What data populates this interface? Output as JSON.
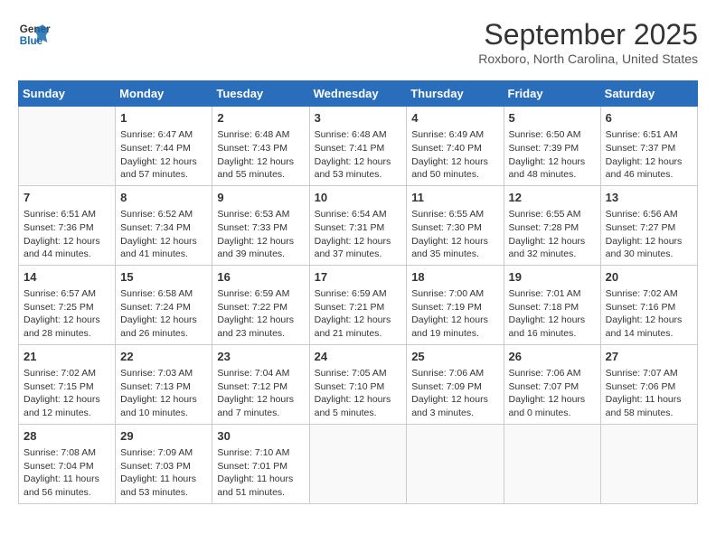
{
  "header": {
    "logo_line1": "General",
    "logo_line2": "Blue",
    "month": "September 2025",
    "location": "Roxboro, North Carolina, United States"
  },
  "weekdays": [
    "Sunday",
    "Monday",
    "Tuesday",
    "Wednesday",
    "Thursday",
    "Friday",
    "Saturday"
  ],
  "weeks": [
    [
      {
        "day": "",
        "info": ""
      },
      {
        "day": "1",
        "info": "Sunrise: 6:47 AM\nSunset: 7:44 PM\nDaylight: 12 hours and 57 minutes."
      },
      {
        "day": "2",
        "info": "Sunrise: 6:48 AM\nSunset: 7:43 PM\nDaylight: 12 hours and 55 minutes."
      },
      {
        "day": "3",
        "info": "Sunrise: 6:48 AM\nSunset: 7:41 PM\nDaylight: 12 hours and 53 minutes."
      },
      {
        "day": "4",
        "info": "Sunrise: 6:49 AM\nSunset: 7:40 PM\nDaylight: 12 hours and 50 minutes."
      },
      {
        "day": "5",
        "info": "Sunrise: 6:50 AM\nSunset: 7:39 PM\nDaylight: 12 hours and 48 minutes."
      },
      {
        "day": "6",
        "info": "Sunrise: 6:51 AM\nSunset: 7:37 PM\nDaylight: 12 hours and 46 minutes."
      }
    ],
    [
      {
        "day": "7",
        "info": "Sunrise: 6:51 AM\nSunset: 7:36 PM\nDaylight: 12 hours and 44 minutes."
      },
      {
        "day": "8",
        "info": "Sunrise: 6:52 AM\nSunset: 7:34 PM\nDaylight: 12 hours and 41 minutes."
      },
      {
        "day": "9",
        "info": "Sunrise: 6:53 AM\nSunset: 7:33 PM\nDaylight: 12 hours and 39 minutes."
      },
      {
        "day": "10",
        "info": "Sunrise: 6:54 AM\nSunset: 7:31 PM\nDaylight: 12 hours and 37 minutes."
      },
      {
        "day": "11",
        "info": "Sunrise: 6:55 AM\nSunset: 7:30 PM\nDaylight: 12 hours and 35 minutes."
      },
      {
        "day": "12",
        "info": "Sunrise: 6:55 AM\nSunset: 7:28 PM\nDaylight: 12 hours and 32 minutes."
      },
      {
        "day": "13",
        "info": "Sunrise: 6:56 AM\nSunset: 7:27 PM\nDaylight: 12 hours and 30 minutes."
      }
    ],
    [
      {
        "day": "14",
        "info": "Sunrise: 6:57 AM\nSunset: 7:25 PM\nDaylight: 12 hours and 28 minutes."
      },
      {
        "day": "15",
        "info": "Sunrise: 6:58 AM\nSunset: 7:24 PM\nDaylight: 12 hours and 26 minutes."
      },
      {
        "day": "16",
        "info": "Sunrise: 6:59 AM\nSunset: 7:22 PM\nDaylight: 12 hours and 23 minutes."
      },
      {
        "day": "17",
        "info": "Sunrise: 6:59 AM\nSunset: 7:21 PM\nDaylight: 12 hours and 21 minutes."
      },
      {
        "day": "18",
        "info": "Sunrise: 7:00 AM\nSunset: 7:19 PM\nDaylight: 12 hours and 19 minutes."
      },
      {
        "day": "19",
        "info": "Sunrise: 7:01 AM\nSunset: 7:18 PM\nDaylight: 12 hours and 16 minutes."
      },
      {
        "day": "20",
        "info": "Sunrise: 7:02 AM\nSunset: 7:16 PM\nDaylight: 12 hours and 14 minutes."
      }
    ],
    [
      {
        "day": "21",
        "info": "Sunrise: 7:02 AM\nSunset: 7:15 PM\nDaylight: 12 hours and 12 minutes."
      },
      {
        "day": "22",
        "info": "Sunrise: 7:03 AM\nSunset: 7:13 PM\nDaylight: 12 hours and 10 minutes."
      },
      {
        "day": "23",
        "info": "Sunrise: 7:04 AM\nSunset: 7:12 PM\nDaylight: 12 hours and 7 minutes."
      },
      {
        "day": "24",
        "info": "Sunrise: 7:05 AM\nSunset: 7:10 PM\nDaylight: 12 hours and 5 minutes."
      },
      {
        "day": "25",
        "info": "Sunrise: 7:06 AM\nSunset: 7:09 PM\nDaylight: 12 hours and 3 minutes."
      },
      {
        "day": "26",
        "info": "Sunrise: 7:06 AM\nSunset: 7:07 PM\nDaylight: 12 hours and 0 minutes."
      },
      {
        "day": "27",
        "info": "Sunrise: 7:07 AM\nSunset: 7:06 PM\nDaylight: 11 hours and 58 minutes."
      }
    ],
    [
      {
        "day": "28",
        "info": "Sunrise: 7:08 AM\nSunset: 7:04 PM\nDaylight: 11 hours and 56 minutes."
      },
      {
        "day": "29",
        "info": "Sunrise: 7:09 AM\nSunset: 7:03 PM\nDaylight: 11 hours and 53 minutes."
      },
      {
        "day": "30",
        "info": "Sunrise: 7:10 AM\nSunset: 7:01 PM\nDaylight: 11 hours and 51 minutes."
      },
      {
        "day": "",
        "info": ""
      },
      {
        "day": "",
        "info": ""
      },
      {
        "day": "",
        "info": ""
      },
      {
        "day": "",
        "info": ""
      }
    ]
  ]
}
